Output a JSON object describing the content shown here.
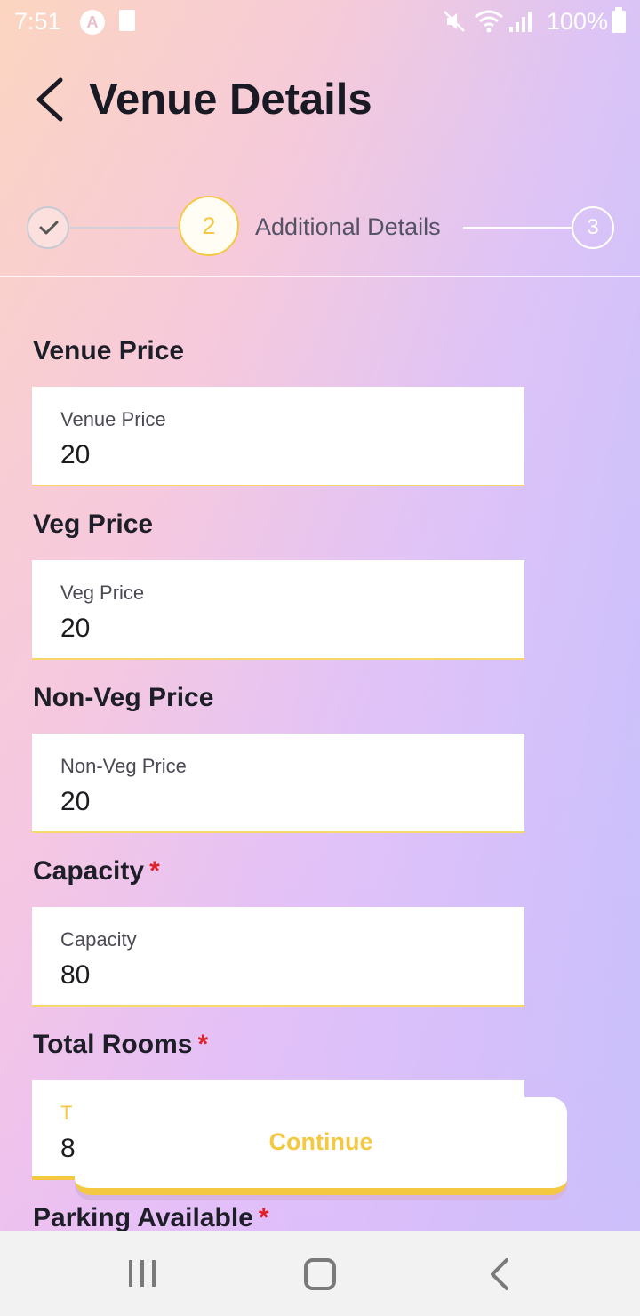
{
  "status_bar": {
    "time": "7:51",
    "battery_percent": "100%",
    "icons": [
      "a-icon",
      "document-icon",
      "mute-icon",
      "wifi-icon",
      "signal-icon",
      "battery-icon"
    ]
  },
  "header": {
    "title": "Venue Details",
    "back_icon": "chevron-left-icon"
  },
  "stepper": {
    "completed_icon": "check-icon",
    "current_step_number": "2",
    "current_step_label": "Additional Details",
    "next_step_number": "3"
  },
  "form": {
    "fields": [
      {
        "section_label": "Venue Price",
        "required": false,
        "float_label": "Venue Price",
        "value": "20"
      },
      {
        "section_label": "Veg Price",
        "required": false,
        "float_label": "Veg Price",
        "value": "20"
      },
      {
        "section_label": "Non-Veg Price",
        "required": false,
        "float_label": "Non-Veg Price",
        "value": "20"
      },
      {
        "section_label": "Capacity",
        "required": true,
        "float_label": "Capacity",
        "value": "80"
      },
      {
        "section_label": "Total Rooms",
        "required": true,
        "float_label": "T",
        "value": "8"
      }
    ],
    "next_section_label": "Parking Available",
    "required_marker": "*"
  },
  "continue_button": {
    "label": "Continue"
  },
  "colors": {
    "accent": "#f5c842",
    "required": "#e0202a",
    "title": "#1a1a24"
  },
  "nav_bar": {
    "icons": [
      "recent-apps-icon",
      "home-icon",
      "back-icon"
    ]
  }
}
